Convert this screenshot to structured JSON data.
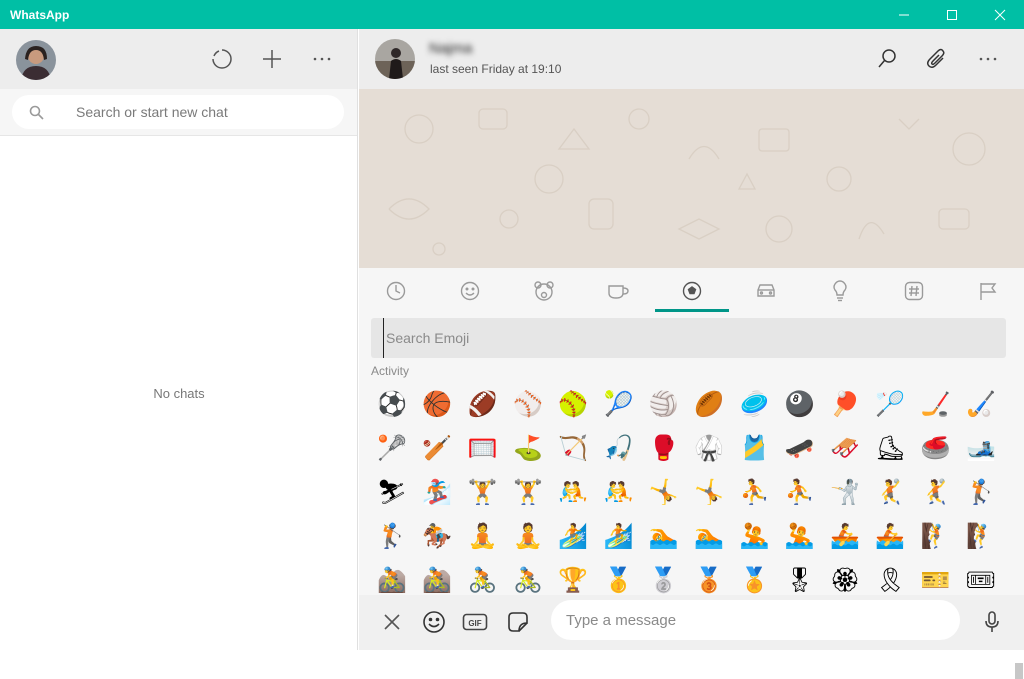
{
  "app": {
    "title": "WhatsApp",
    "accent_color": "#00bfa5"
  },
  "window_controls": [
    "minimize",
    "maximize",
    "close"
  ],
  "sidebar": {
    "header_icons": [
      "status-icon",
      "new-chat-icon",
      "more-icon"
    ],
    "search_placeholder": "Search or start new chat",
    "empty_text": "No chats"
  },
  "chat": {
    "contact_name": "Najma",
    "last_seen": "last seen Friday at 19:10",
    "header_icons": [
      "search-icon",
      "attach-icon",
      "more-icon"
    ]
  },
  "emoji_panel": {
    "tabs": [
      "recent",
      "smileys",
      "animals",
      "food",
      "activity",
      "travel",
      "objects",
      "symbols",
      "flags"
    ],
    "active_tab": "activity",
    "search_placeholder": "Search Emoji",
    "category_label": "Activity",
    "emojis": [
      [
        "⚽",
        "🏀",
        "🏈",
        "⚾",
        "🥎",
        "🎾",
        "🏐",
        "🏉",
        "🥏",
        "🎱",
        "🏓",
        "🏸",
        "🏒",
        "🏑"
      ],
      [
        "🥍",
        "🏏",
        "🥅",
        "⛳",
        "🏹",
        "🎣",
        "🥊",
        "🥋",
        "🎽",
        "🛹",
        "🛷",
        "⛸",
        "🥌",
        "🎿"
      ],
      [
        "⛷",
        "🏂",
        "🏋",
        "🏋",
        "🤼",
        "🤼",
        "🤸",
        "🤸",
        "⛹",
        "⛹",
        "🤺",
        "🤾",
        "🤾",
        "🏌"
      ],
      [
        "🏌",
        "🏇",
        "🧘",
        "🧘",
        "🏄",
        "🏄",
        "🏊",
        "🏊",
        "🤽",
        "🤽",
        "🚣",
        "🚣",
        "🧗",
        "🧗"
      ],
      [
        "🚵",
        "🚵",
        "🚴",
        "🚴",
        "🏆",
        "🥇",
        "🥈",
        "🥉",
        "🏅",
        "🎖",
        "🏵",
        "🎗",
        "🎫",
        "🎟"
      ]
    ]
  },
  "input_bar": {
    "placeholder": "Type a message",
    "left_icons": [
      "close-icon",
      "emoji-icon",
      "gif-icon",
      "sticker-icon"
    ],
    "gif_label": "GIF",
    "right_icon": "microphone-icon"
  }
}
